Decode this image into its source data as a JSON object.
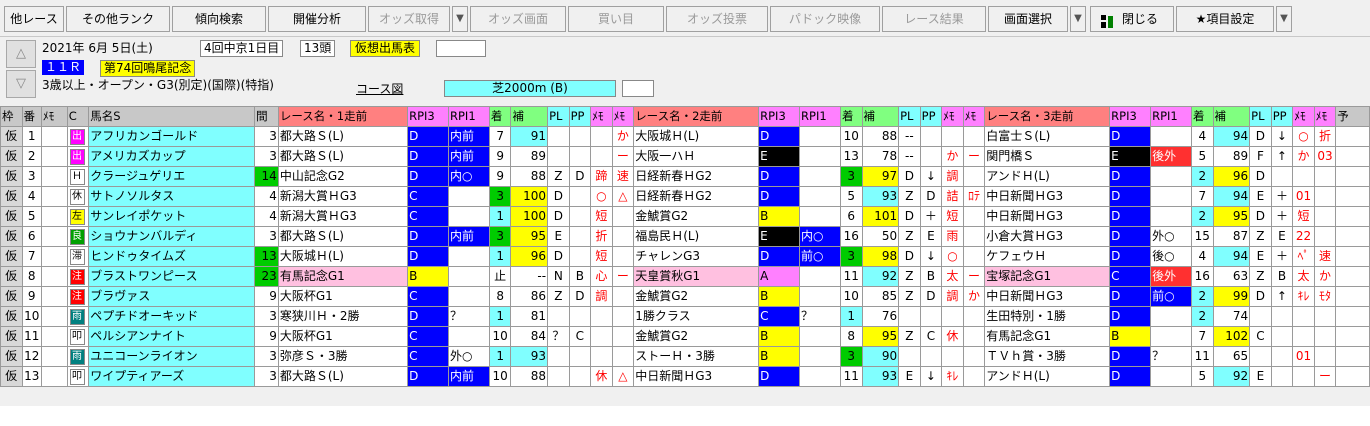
{
  "toolbar": {
    "buttons": [
      "他レース",
      "その他ランク",
      "傾向検索",
      "開催分析",
      "オッズ取得",
      "オッズ画面",
      "買い目",
      "オッズ投票",
      "パドック映像",
      "レース結果",
      "画面選択",
      "閉じる",
      "★項目設定"
    ]
  },
  "race": {
    "date": "2021年 6月 5日(土)",
    "meeting": "4回中京1日目",
    "heads": "13頭",
    "card_type": "仮想出馬表",
    "race_no": "１１Ｒ",
    "race_name": "第74回鳴尾記念",
    "conditions": "3歳以上・オープン・G3(別定)(国際)(特指)",
    "course_label": "コース図",
    "course": "芝2000m (B)"
  },
  "header": [
    "枠",
    "番",
    "ﾒﾓ",
    "C",
    "馬名S",
    "間",
    "レース名・1走前",
    "RPI3",
    "RPI1",
    "着",
    "補",
    "PL",
    "PP",
    "ﾒﾓ",
    "ﾒﾓ",
    "レース名・2走前",
    "RPI3",
    "RPI1",
    "着",
    "補",
    "PL",
    "PP",
    "ﾒﾓ",
    "ﾒﾓ",
    "レース名・3走前",
    "RPI3",
    "RPI1",
    "着",
    "補",
    "PL",
    "PP",
    "ﾒﾓ",
    "ﾒﾓ",
    "予"
  ],
  "rows": [
    {
      "w": "仮",
      "n": "1",
      "fr": "出",
      "frc": "magenta",
      "name": "アフリカンゴールド",
      "nc": "cyan",
      "k": "3",
      "r1": "都大路Ｓ(L)",
      "r1c": "",
      "a3": "D",
      "a3c": "blue",
      "a1": "内前",
      "a1c": "blue",
      "c1": "7",
      "c1c": "",
      "h1": "91",
      "h1c": "cyan",
      "p1": "",
      "pp1": "",
      "m1a": "",
      "m1b": "か",
      "r2": "大阪城Ｈ(L)",
      "r2c": "",
      "b3": "D",
      "b3c": "blue",
      "b1": "",
      "b1c": "",
      "c2": "10",
      "c2c": "",
      "h2": "88",
      "h2c": "",
      "p2": "--",
      "pp2": "",
      "m2a": "",
      "m2b": "",
      "r3": "白富士Ｓ(L)",
      "r3c": "",
      "d3": "D",
      "d3c": "blue",
      "d1": "",
      "d1c": "",
      "c3": "4",
      "c3c": "",
      "h3": "94",
      "h3c": "cyan",
      "p3": "D",
      "pp3": "↓",
      "m3a": "○",
      "m3b": "折"
    },
    {
      "w": "仮",
      "n": "2",
      "fr": "出",
      "frc": "magenta",
      "name": "アメリカズカップ",
      "nc": "cyan",
      "k": "3",
      "r1": "都大路Ｓ(L)",
      "r1c": "",
      "a3": "D",
      "a3c": "blue",
      "a1": "内前",
      "a1c": "blue",
      "c1": "9",
      "c1c": "",
      "h1": "89",
      "h1c": "",
      "p1": "",
      "pp1": "",
      "m1a": "",
      "m1b": "ー",
      "r2": "大阪一ハＨ",
      "r2c": "",
      "b3": "E",
      "b3c": "black",
      "b1": "",
      "b1c": "",
      "c2": "13",
      "c2c": "",
      "h2": "78",
      "h2c": "",
      "p2": "--",
      "pp2": "",
      "m2a": "か",
      "m2b": "ー",
      "r3": "関門橋Ｓ",
      "r3c": "",
      "d3": "E",
      "d3c": "black",
      "d1": "後外",
      "d1c": "red",
      "c3": "5",
      "c3c": "",
      "h3": "89",
      "h3c": "",
      "p3": "F",
      "pp3": "↑",
      "m3a": "か",
      "m3b": "03"
    },
    {
      "w": "仮",
      "n": "3",
      "fr": "Ｈ",
      "frc": "white",
      "name": "クラージュゲリエ",
      "nc": "cyan",
      "k": "14",
      "kc": "green",
      "r1": "中山記念G2",
      "r1c": "",
      "a3": "D",
      "a3c": "blue",
      "a1": "内○",
      "a1c": "blue",
      "c1": "9",
      "c1c": "",
      "h1": "88",
      "h1c": "",
      "p1": "Z",
      "pp1": "D",
      "m1a": "蹄",
      "m1b": "速",
      "r2": "日経新春ＨG2",
      "r2c": "",
      "b3": "D",
      "b3c": "blue",
      "b1": "",
      "b1c": "",
      "c2": "3",
      "c2c": "green",
      "h2": "97",
      "h2c": "yellow",
      "p2": "D",
      "pp2": "↓",
      "m2a": "調",
      "m2b": "",
      "r3": "アンドＨ(L)",
      "r3c": "",
      "d3": "D",
      "d3c": "blue",
      "d1": "",
      "d1c": "",
      "c3": "2",
      "c3c": "cyan",
      "h3": "96",
      "h3c": "yellow",
      "p3": "D",
      "pp3": "",
      "m3a": "",
      "m3b": ""
    },
    {
      "w": "仮",
      "n": "4",
      "fr": "休",
      "frc": "white",
      "name": "サトノソルタス",
      "nc": "cyan",
      "k": "4",
      "r1": "新潟大賞ＨG3",
      "r1c": "",
      "a3": "C",
      "a3c": "blue",
      "a1": "",
      "a1c": "",
      "c1": "3",
      "c1c": "green",
      "h1": "100",
      "h1c": "yellow",
      "p1": "D",
      "pp1": "",
      "m1a": "○",
      "m1b": "△",
      "r2": "日経新春ＨG2",
      "r2c": "",
      "b3": "D",
      "b3c": "blue",
      "b1": "",
      "b1c": "",
      "c2": "5",
      "c2c": "",
      "h2": "93",
      "h2c": "cyan",
      "p2": "Z",
      "pp2": "D",
      "m2a": "詰",
      "m2b": "ﾛﾃ",
      "r3": "中日新聞ＨG3",
      "r3c": "",
      "d3": "D",
      "d3c": "blue",
      "d1": "",
      "d1c": "",
      "c3": "7",
      "c3c": "",
      "h3": "94",
      "h3c": "cyan",
      "p3": "E",
      "pp3": "＋",
      "m3a": "01",
      "m3b": ""
    },
    {
      "w": "仮",
      "n": "5",
      "fr": "左",
      "frc": "yellow",
      "name": "サンレイポケット",
      "nc": "cyan",
      "k": "4",
      "r1": "新潟大賞ＨG3",
      "r1c": "",
      "a3": "C",
      "a3c": "blue",
      "a1": "",
      "a1c": "",
      "c1": "1",
      "c1c": "cyan",
      "h1": "100",
      "h1c": "yellow",
      "p1": "D",
      "pp1": "",
      "m1a": "短",
      "m1b": "",
      "r2": "金鯱賞G2",
      "r2c": "",
      "b3": "B",
      "b3c": "yellow",
      "b1": "",
      "b1c": "",
      "c2": "6",
      "c2c": "",
      "h2": "101",
      "h2c": "yellow",
      "p2": "D",
      "pp2": "＋",
      "m2a": "短",
      "m2b": "",
      "r3": "中日新聞ＨG3",
      "r3c": "",
      "d3": "D",
      "d3c": "blue",
      "d1": "",
      "d1c": "",
      "c3": "2",
      "c3c": "cyan",
      "h3": "95",
      "h3c": "yellow",
      "p3": "D",
      "pp3": "＋",
      "m3a": "短",
      "m3b": ""
    },
    {
      "w": "仮",
      "n": "6",
      "fr": "良",
      "frc": "green",
      "name": "ショウナンバルディ",
      "nc": "cyan",
      "k": "3",
      "r1": "都大路Ｓ(L)",
      "r1c": "",
      "a3": "D",
      "a3c": "blue",
      "a1": "内前",
      "a1c": "blue",
      "c1": "3",
      "c1c": "green",
      "h1": "95",
      "h1c": "yellow",
      "p1": "E",
      "pp1": "",
      "m1a": "折",
      "m1b": "",
      "r2": "福島民Ｈ(L)",
      "r2c": "",
      "b3": "E",
      "b3c": "black",
      "b1": "内○",
      "b1c": "blue",
      "c2": "16",
      "c2c": "",
      "h2": "50",
      "h2c": "",
      "p2": "Z",
      "pp2": "E",
      "m2a": "雨",
      "m2b": "",
      "r3": "小倉大賞ＨG3",
      "r3c": "",
      "d3": "D",
      "d3c": "blue",
      "d1": "外○",
      "d1c": "",
      "c3": "15",
      "c3c": "",
      "h3": "87",
      "h3c": "",
      "p3": "Z",
      "pp3": "E",
      "m3a": "22",
      "m3b": ""
    },
    {
      "w": "仮",
      "n": "7",
      "fr": "滞",
      "frc": "white",
      "name": "ヒンドゥタイムズ",
      "nc": "cyan",
      "k": "13",
      "kc": "green",
      "r1": "大阪城Ｈ(L)",
      "r1c": "",
      "a3": "D",
      "a3c": "blue",
      "a1": "",
      "a1c": "",
      "c1": "1",
      "c1c": "cyan",
      "h1": "96",
      "h1c": "yellow",
      "p1": "D",
      "pp1": "",
      "m1a": "短",
      "m1b": "",
      "r2": "チャレンG3",
      "r2c": "",
      "b3": "D",
      "b3c": "blue",
      "b1": "前○",
      "b1c": "blue",
      "c2": "3",
      "c2c": "green",
      "h2": "98",
      "h2c": "yellow",
      "p2": "D",
      "pp2": "↓",
      "m2a": "○",
      "m2b": "",
      "r3": "ケフェウＨ",
      "r3c": "",
      "d3": "D",
      "d3c": "blue",
      "d1": "後○",
      "d1c": "",
      "c3": "4",
      "c3c": "",
      "h3": "94",
      "h3c": "cyan",
      "p3": "E",
      "pp3": "＋",
      "m3a": "ﾍﾟ",
      "m3b": "速"
    },
    {
      "w": "仮",
      "n": "8",
      "fr": "注",
      "frc": "red",
      "name": "ブラストワンピース",
      "nc": "cyan",
      "k": "23",
      "kc": "green",
      "r1": "有馬記念G1",
      "r1c": "pink",
      "a3": "B",
      "a3c": "yellow",
      "a1": "",
      "a1c": "",
      "c1": "止",
      "c1c": "",
      "h1": "--",
      "h1c": "",
      "p1": "N",
      "pp1": "B",
      "m1a": "心",
      "m1b": "ー",
      "r2": "天皇賞秋G1",
      "r2c": "pink",
      "b3": "A",
      "b3c": "magenta",
      "b1": "",
      "b1c": "",
      "c2": "11",
      "c2c": "",
      "h2": "92",
      "h2c": "cyan",
      "p2": "Z",
      "pp2": "B",
      "m2a": "太",
      "m2b": "ー",
      "r3": "宝塚記念G1",
      "r3c": "pink",
      "d3": "C",
      "d3c": "blue",
      "d1": "後外",
      "d1c": "red",
      "c3": "16",
      "c3c": "",
      "h3": "63",
      "h3c": "",
      "p3": "Z",
      "pp3": "B",
      "m3a": "太",
      "m3b": "か"
    },
    {
      "w": "仮",
      "n": "9",
      "fr": "注",
      "frc": "red",
      "name": "ブラヴァス",
      "nc": "cyan",
      "k": "9",
      "r1": "大阪杯G1",
      "r1c": "",
      "a3": "C",
      "a3c": "blue",
      "a1": "",
      "a1c": "",
      "c1": "8",
      "c1c": "",
      "h1": "86",
      "h1c": "",
      "p1": "Z",
      "pp1": "D",
      "m1a": "調",
      "m1b": "",
      "r2": "金鯱賞G2",
      "r2c": "",
      "b3": "B",
      "b3c": "yellow",
      "b1": "",
      "b1c": "",
      "c2": "10",
      "c2c": "",
      "h2": "85",
      "h2c": "",
      "p2": "Z",
      "pp2": "D",
      "m2a": "調",
      "m2b": "か",
      "r3": "中日新聞ＨG3",
      "r3c": "",
      "d3": "D",
      "d3c": "blue",
      "d1": "前○",
      "d1c": "blue",
      "c3": "2",
      "c3c": "cyan",
      "h3": "99",
      "h3c": "yellow",
      "p3": "D",
      "pp3": "↑",
      "m3a": "ｷﾚ",
      "m3b": "ﾓﾀ"
    },
    {
      "w": "仮",
      "n": "10",
      "fr": "雨",
      "frc": "teal",
      "name": "ペプチドオーキッド",
      "nc": "cyan",
      "k": "3",
      "r1": "寒狭川Ｈ・2勝",
      "r1c": "",
      "a3": "D",
      "a3c": "blue",
      "a1": "？",
      "a1c": "",
      "c1": "1",
      "c1c": "cyan",
      "h1": "81",
      "h1c": "",
      "p1": "",
      "pp1": "",
      "m1a": "",
      "m1b": "",
      "r2": "1勝クラス",
      "r2c": "",
      "b3": "C",
      "b3c": "blue",
      "b1": "？",
      "b1c": "",
      "c2": "1",
      "c2c": "cyan",
      "h2": "76",
      "h2c": "",
      "p2": "",
      "pp2": "",
      "m2a": "",
      "m2b": "",
      "r3": "生田特別・1勝",
      "r3c": "",
      "d3": "D",
      "d3c": "blue",
      "d1": "",
      "d1c": "",
      "c3": "2",
      "c3c": "cyan",
      "h3": "74",
      "h3c": "",
      "p3": "",
      "pp3": "",
      "m3a": "",
      "m3b": ""
    },
    {
      "w": "仮",
      "n": "11",
      "fr": "叩",
      "frc": "white",
      "name": "ペルシアンナイト",
      "nc": "cyan",
      "k": "9",
      "r1": "大阪杯G1",
      "r1c": "",
      "a3": "C",
      "a3c": "blue",
      "a1": "",
      "a1c": "",
      "c1": "10",
      "c1c": "",
      "h1": "84",
      "h1c": "",
      "p1": "？",
      "pp1": "C",
      "m1a": "",
      "m1b": "",
      "r2": "金鯱賞G2",
      "r2c": "",
      "b3": "B",
      "b3c": "yellow",
      "b1": "",
      "b1c": "",
      "c2": "8",
      "c2c": "",
      "h2": "95",
      "h2c": "yellow",
      "p2": "Z",
      "pp2": "C",
      "m2a": "休",
      "m2b": "",
      "r3": "有馬記念G1",
      "r3c": "",
      "d3": "B",
      "d3c": "yellow",
      "d1": "",
      "d1c": "",
      "c3": "7",
      "c3c": "",
      "h3": "102",
      "h3c": "yellow",
      "p3": "C",
      "pp3": "",
      "m3a": "",
      "m3b": ""
    },
    {
      "w": "仮",
      "n": "12",
      "fr": "雨",
      "frc": "teal",
      "name": "ユニコーンライオン",
      "nc": "cyan",
      "k": "3",
      "r1": "弥彦Ｓ・3勝",
      "r1c": "",
      "a3": "C",
      "a3c": "blue",
      "a1": "外○",
      "a1c": "",
      "c1": "1",
      "c1c": "cyan",
      "h1": "93",
      "h1c": "cyan",
      "p1": "",
      "pp1": "",
      "m1a": "",
      "m1b": "",
      "r2": "ストーＨ・3勝",
      "r2c": "",
      "b3": "B",
      "b3c": "yellow",
      "b1": "",
      "b1c": "",
      "c2": "3",
      "c2c": "green",
      "h2": "90",
      "h2c": "cyan",
      "p2": "",
      "pp2": "",
      "m2a": "",
      "m2b": "",
      "r3": "ＴＶｈ賞・3勝",
      "r3c": "",
      "d3": "D",
      "d3c": "blue",
      "d1": "？",
      "d1c": "",
      "c3": "11",
      "c3c": "",
      "h3": "65",
      "h3c": "",
      "p3": "",
      "pp3": "",
      "m3a": "01",
      "m3b": ""
    },
    {
      "w": "仮",
      "n": "13",
      "fr": "叩",
      "frc": "white",
      "name": "ワイプティアーズ",
      "nc": "cyan",
      "k": "3",
      "r1": "都大路Ｓ(L)",
      "r1c": "",
      "a3": "D",
      "a3c": "blue",
      "a1": "内前",
      "a1c": "blue",
      "c1": "10",
      "c1c": "",
      "h1": "88",
      "h1c": "",
      "p1": "",
      "pp1": "",
      "m1a": "休",
      "m1b": "△",
      "r2": "中日新聞ＨG3",
      "r2c": "",
      "b3": "D",
      "b3c": "blue",
      "b1": "",
      "b1c": "",
      "c2": "11",
      "c2c": "",
      "h2": "93",
      "h2c": "cyan",
      "p2": "E",
      "pp2": "↓",
      "m2a": "ｷﾚ",
      "m2b": "",
      "r3": "アンドＨ(L)",
      "r3c": "",
      "d3": "D",
      "d3c": "blue",
      "d1": "",
      "d1c": "",
      "c3": "5",
      "c3c": "",
      "h3": "92",
      "h3c": "cyan",
      "p3": "E",
      "pp3": "",
      "m3a": "",
      "m3b": "ー"
    }
  ]
}
